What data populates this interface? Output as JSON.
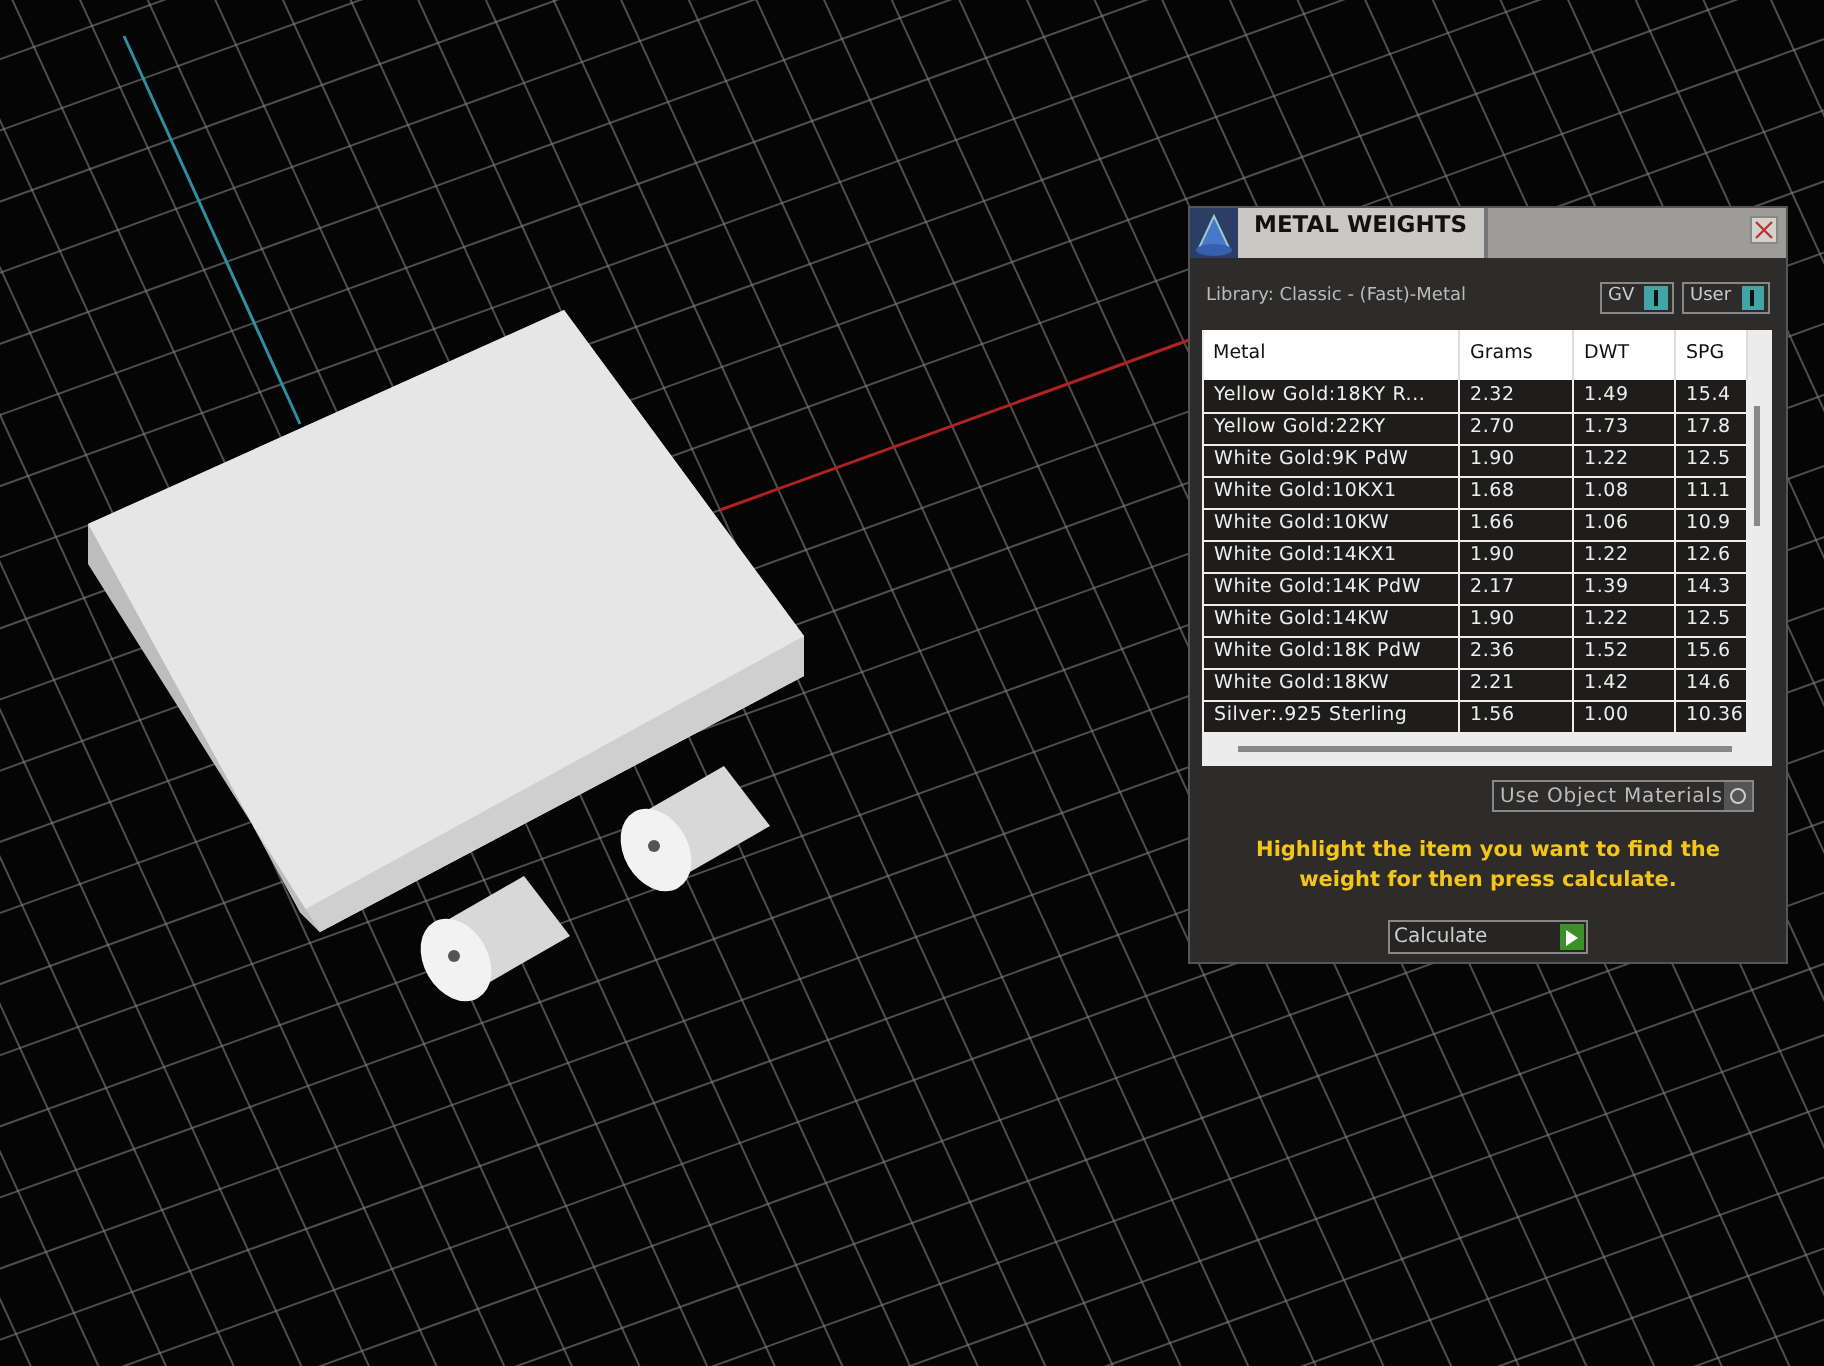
{
  "panel": {
    "title": "METAL WEIGHTS",
    "library": "Library: Classic - (Fast)-Metal",
    "toggles": [
      {
        "label": "GV",
        "on": true
      },
      {
        "label": "User",
        "on": true
      }
    ],
    "table": {
      "columns": [
        "Metal",
        "Grams",
        "DWT",
        "SPG"
      ],
      "rows": [
        [
          "Yellow Gold:18KY R...",
          "2.32",
          "1.49",
          "15.4"
        ],
        [
          "Yellow Gold:22KY",
          "2.70",
          "1.73",
          "17.8"
        ],
        [
          "White Gold:9K PdW",
          "1.90",
          "1.22",
          "12.5"
        ],
        [
          "White Gold:10KX1",
          "1.68",
          "1.08",
          "11.1"
        ],
        [
          "White Gold:10KW",
          "1.66",
          "1.06",
          "10.9"
        ],
        [
          "White Gold:14KX1",
          "1.90",
          "1.22",
          "12.6"
        ],
        [
          "White Gold:14K PdW",
          "2.17",
          "1.39",
          "14.3"
        ],
        [
          "White Gold:14KW",
          "1.90",
          "1.22",
          "12.5"
        ],
        [
          "White Gold:18K PdW",
          "2.36",
          "1.52",
          "15.6"
        ],
        [
          "White Gold:18KW",
          "2.21",
          "1.42",
          "14.6"
        ],
        [
          "Silver:.925 Sterling",
          "1.56",
          "1.00",
          "10.36"
        ]
      ]
    },
    "option": {
      "label": "Use Object Materials",
      "checked": false
    },
    "hint": "Highlight the item you want to find the weight for then press calculate.",
    "button": "Calculate"
  }
}
